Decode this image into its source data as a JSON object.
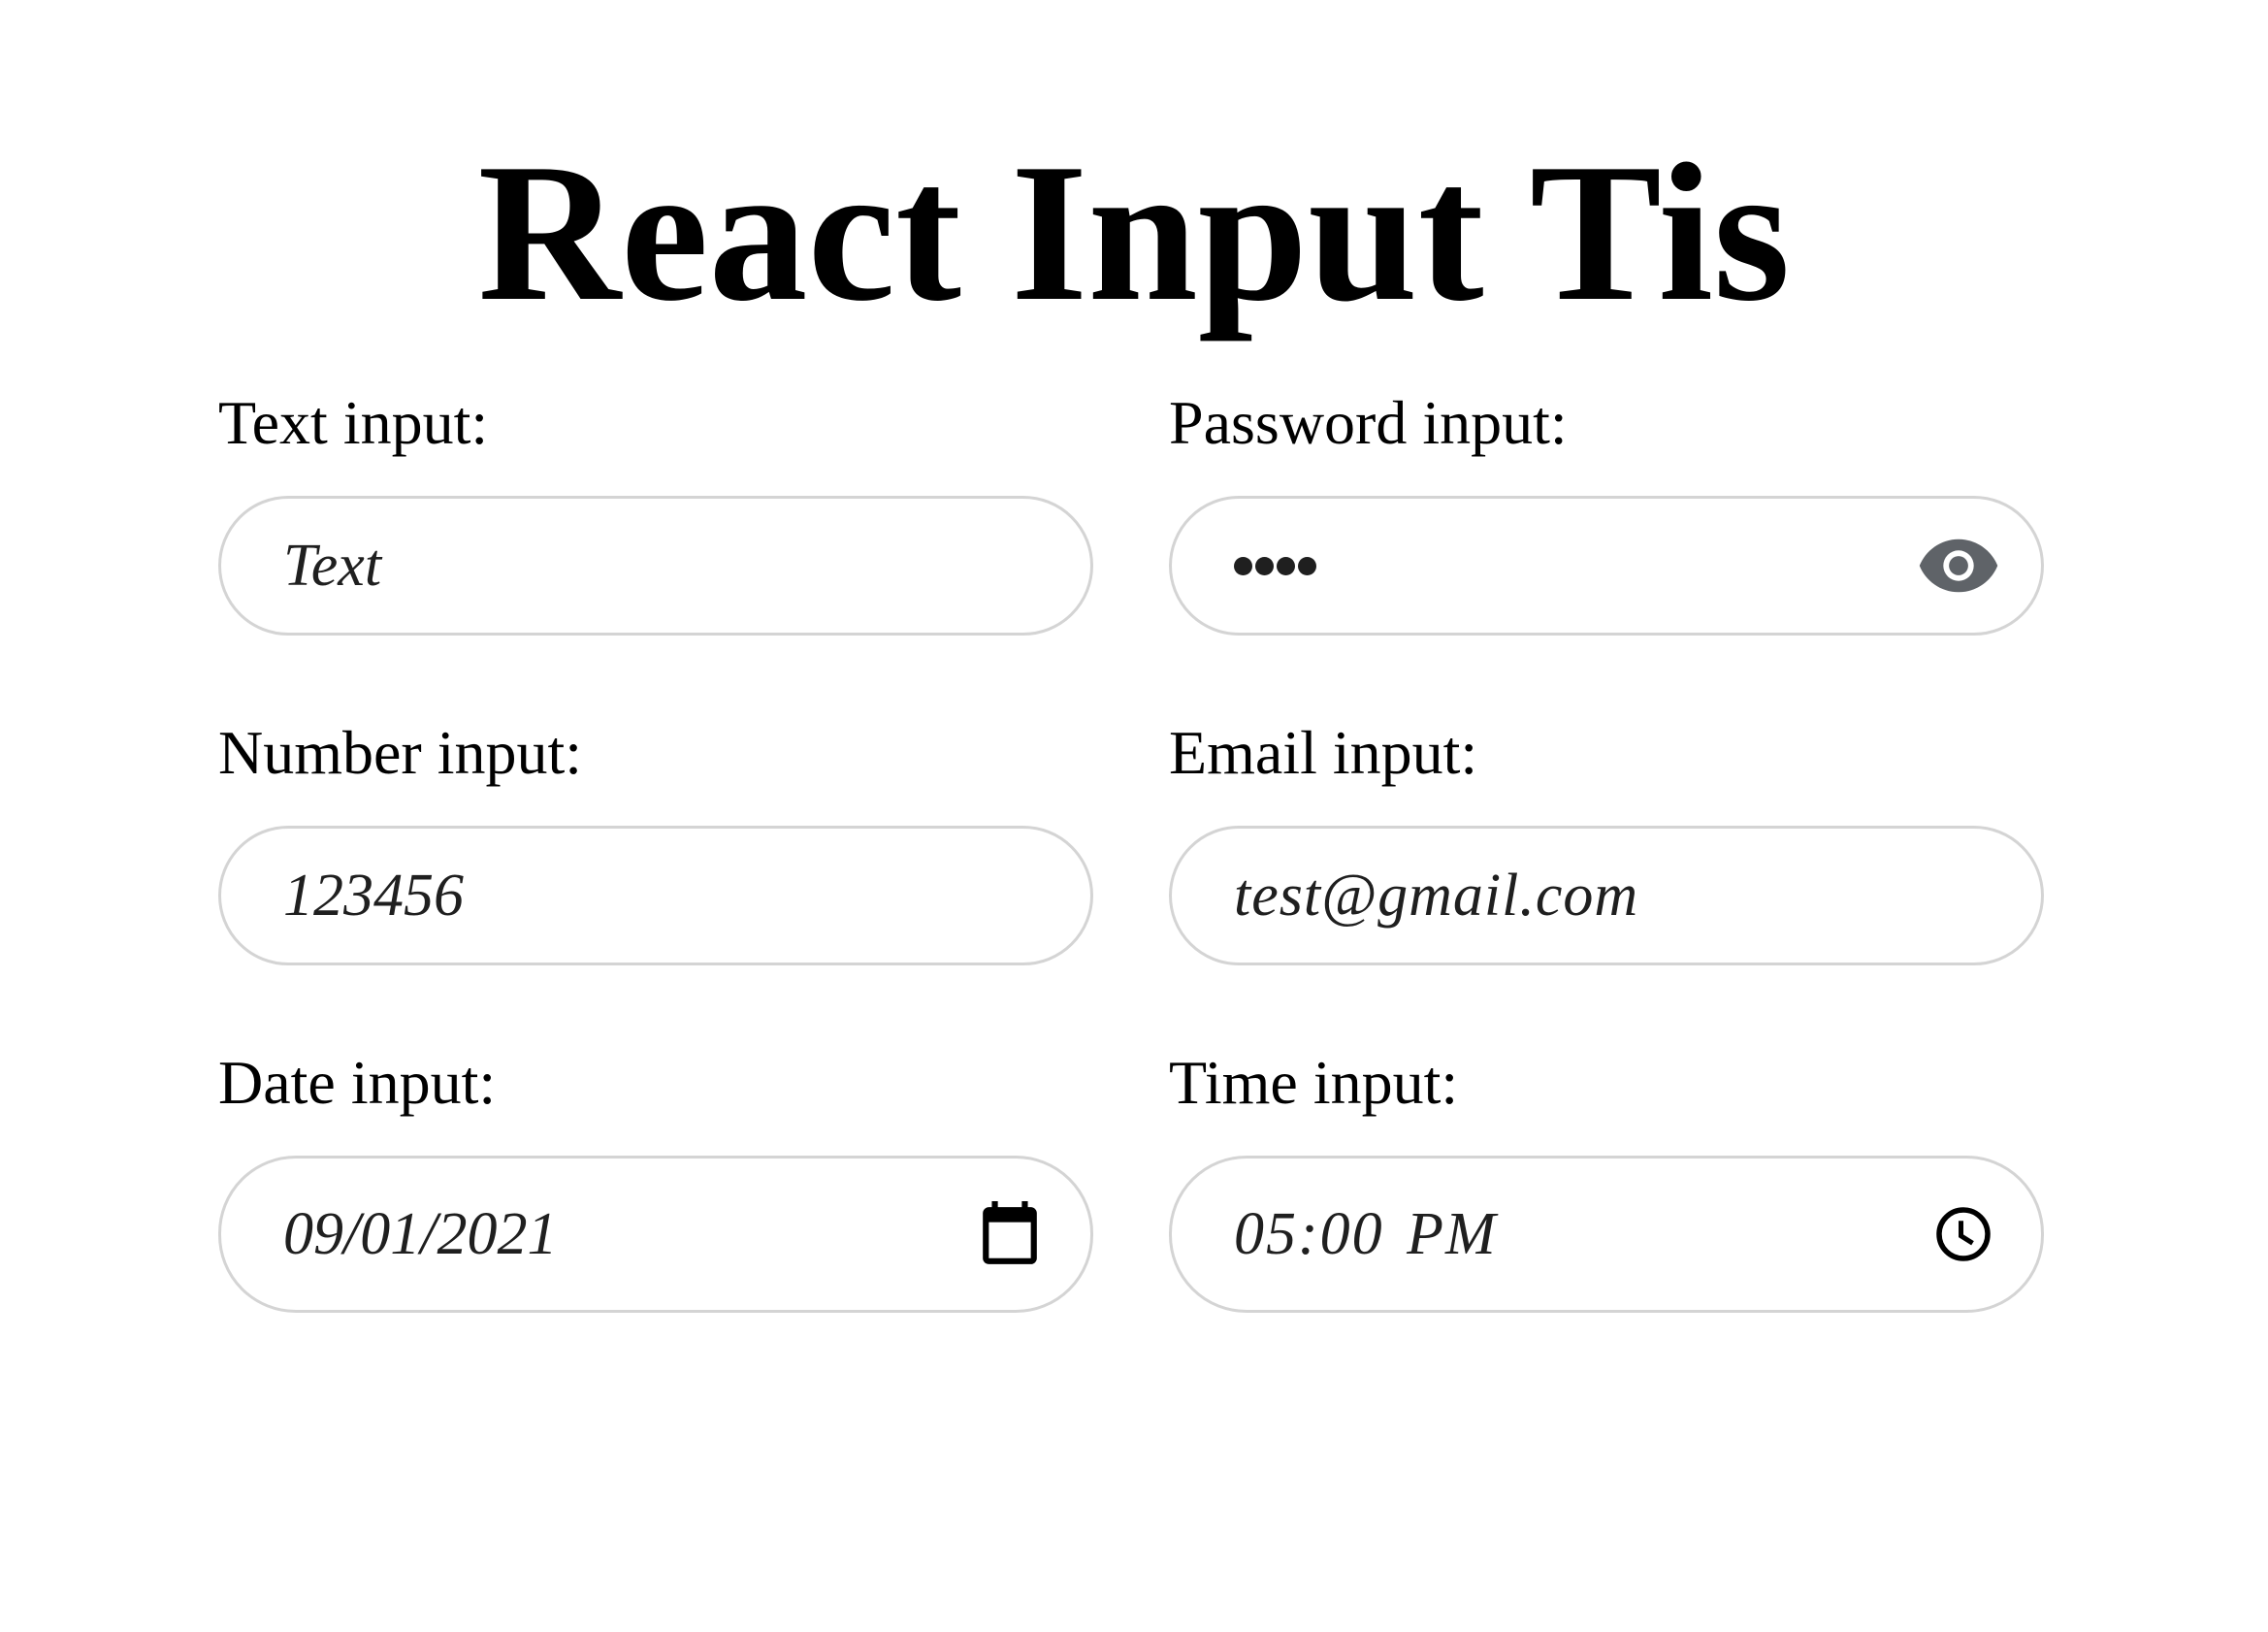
{
  "page": {
    "title": "React Input Tis"
  },
  "fields": {
    "text": {
      "label": "Text input:",
      "value": "Text"
    },
    "password": {
      "label": "Password input:",
      "value_masked_length": 4,
      "icon": "eye-icon"
    },
    "number": {
      "label": "Number input:",
      "value": "123456"
    },
    "email": {
      "label": "Email input:",
      "value": "test@gmail.com"
    },
    "date": {
      "label": "Date input:",
      "value": "09/01/2021",
      "icon": "calendar-icon"
    },
    "time": {
      "label": "Time input:",
      "value": "05:00 PM",
      "icon": "clock-icon"
    }
  },
  "colors": {
    "border": "#d4d4d4",
    "text": "#1f1f1f",
    "eye_icon": "#5f6368"
  }
}
